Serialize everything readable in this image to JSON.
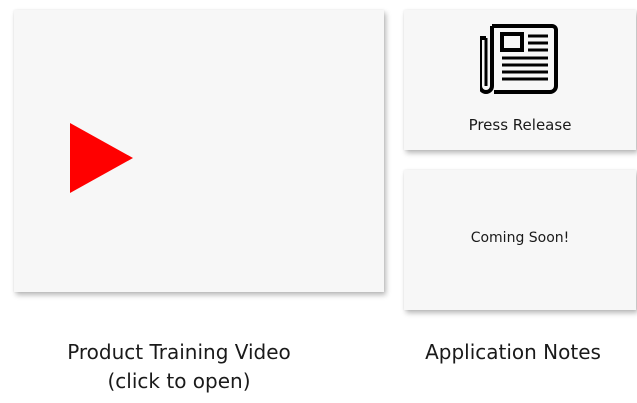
{
  "video": {
    "caption_line1": "Product Training Video",
    "caption_line2": "(click to open)",
    "icon": "play-icon",
    "icon_color": "#ff0000"
  },
  "press": {
    "label": "Press Release",
    "icon": "newspaper-icon"
  },
  "notes": {
    "label": "Coming Soon!",
    "caption": "Application Notes"
  }
}
